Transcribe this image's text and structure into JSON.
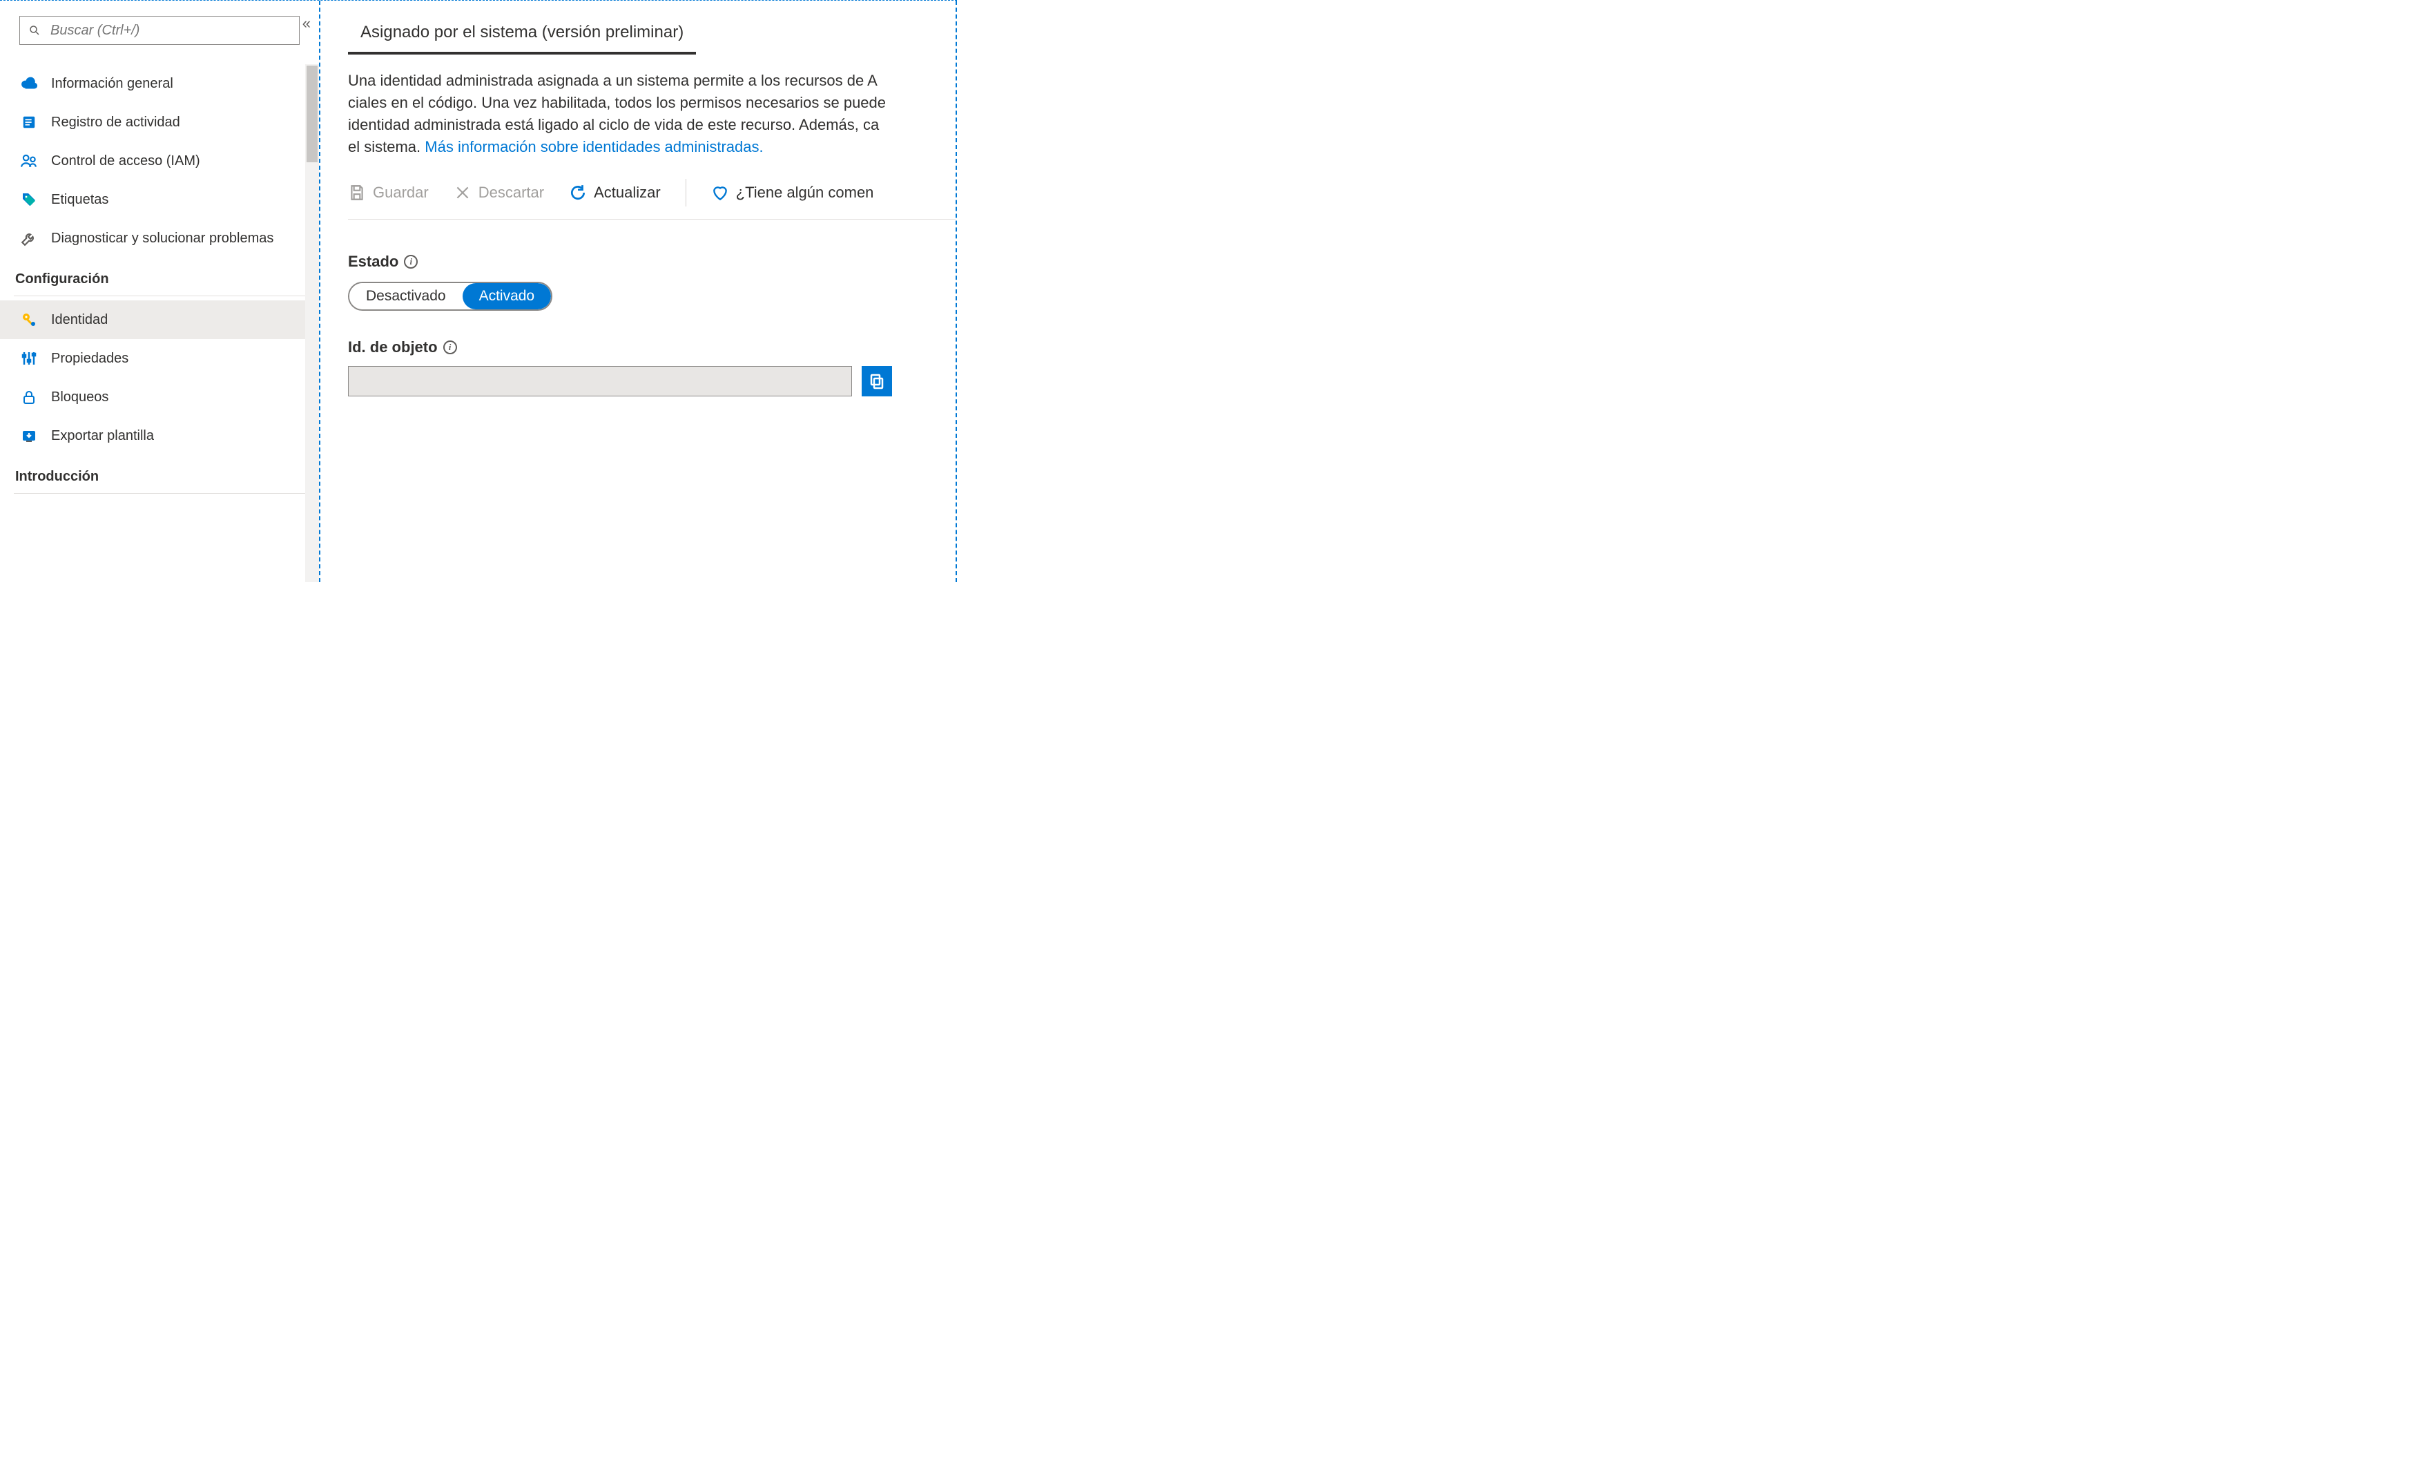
{
  "sidebar": {
    "search_placeholder": "Buscar (Ctrl+/)",
    "items_top": [
      {
        "label": "Información general",
        "icon": "cloud-icon"
      },
      {
        "label": "Registro de actividad",
        "icon": "activity-log-icon"
      },
      {
        "label": "Control de acceso (IAM)",
        "icon": "people-icon"
      },
      {
        "label": "Etiquetas",
        "icon": "tags-icon"
      },
      {
        "label": "Diagnosticar y solucionar problemas",
        "icon": "wrench-icon"
      }
    ],
    "section_config": "Configuración",
    "items_config": [
      {
        "label": "Identidad",
        "icon": "key-icon",
        "selected": true
      },
      {
        "label": "Propiedades",
        "icon": "sliders-icon"
      },
      {
        "label": "Bloqueos",
        "icon": "lock-icon"
      },
      {
        "label": "Exportar plantilla",
        "icon": "export-icon"
      }
    ],
    "section_intro": "Introducción"
  },
  "main": {
    "tab_label": "Asignado por el sistema (versión preliminar)",
    "description_1": "Una identidad administrada asignada a un sistema permite a los recursos de A",
    "description_2": "ciales en el código. Una vez habilitada, todos los permisos necesarios se puede",
    "description_3": "identidad administrada está ligado al ciclo de vida de este recurso. Además, ca",
    "description_4_prefix": "el sistema. ",
    "description_link": "Más información sobre identidades administradas.",
    "toolbar": {
      "save": "Guardar",
      "discard": "Descartar",
      "refresh": "Actualizar",
      "feedback": "¿Tiene algún comen"
    },
    "state": {
      "label": "Estado",
      "off": "Desactivado",
      "on": "Activado",
      "value": "on"
    },
    "objectid": {
      "label": "Id. de objeto",
      "value": ""
    }
  }
}
